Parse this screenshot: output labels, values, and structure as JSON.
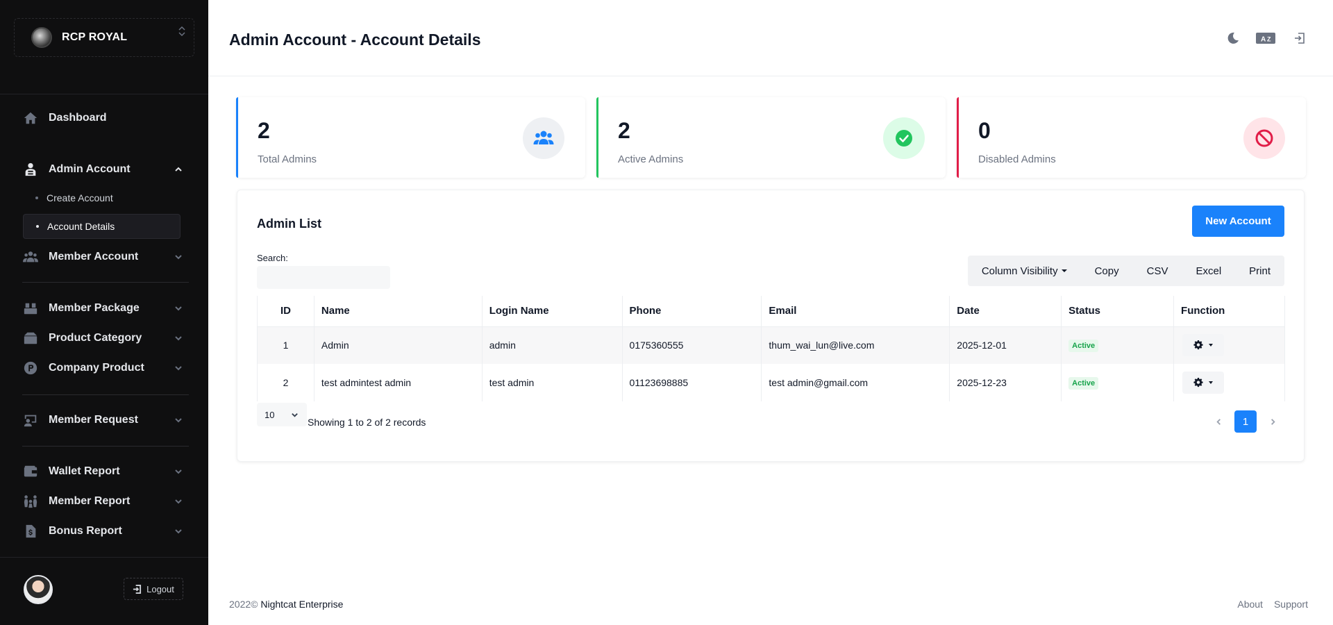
{
  "brand": {
    "name": "RCP ROYAL"
  },
  "sidebar": {
    "items": [
      {
        "label": "Dashboard",
        "icon": "home-icon"
      },
      {
        "label": "Admin Account",
        "icon": "admin-icon"
      },
      {
        "label": "Member Account",
        "icon": "users-icon"
      },
      {
        "label": "Member Package",
        "icon": "package-icon"
      },
      {
        "label": "Product Category",
        "icon": "category-icon"
      },
      {
        "label": "Company Product",
        "icon": "product-icon"
      },
      {
        "label": "Member Request",
        "icon": "request-icon"
      },
      {
        "label": "Wallet Report",
        "icon": "wallet-icon"
      },
      {
        "label": "Member Report",
        "icon": "member-report-icon"
      },
      {
        "label": "Bonus Report",
        "icon": "bonus-icon"
      }
    ],
    "sub_items": [
      {
        "label": "Create Account"
      },
      {
        "label": "Account Details"
      }
    ],
    "logout_label": "Logout"
  },
  "header": {
    "title": "Admin Account - Account Details"
  },
  "stats": [
    {
      "value": "2",
      "label": "Total Admins",
      "color": "#1a82fb"
    },
    {
      "value": "2",
      "label": "Active Admins",
      "color": "#22c55e"
    },
    {
      "value": "0",
      "label": "Disabled Admins",
      "color": "#e11d48"
    }
  ],
  "list": {
    "title": "Admin List",
    "new_button": "New Account",
    "search_label": "Search:",
    "search_value": "",
    "buttons": {
      "column_visibility": "Column Visibility",
      "copy": "Copy",
      "csv": "CSV",
      "excel": "Excel",
      "print": "Print"
    },
    "columns": [
      "ID",
      "Name",
      "Login Name",
      "Phone",
      "Email",
      "Date",
      "Status",
      "Function"
    ],
    "rows": [
      {
        "id": "1",
        "name": "Admin",
        "login": "admin",
        "phone": "0175360555",
        "email": "thum_wai_lun@live.com",
        "date": "2025-12-01",
        "status": "Active"
      },
      {
        "id": "2",
        "name": "test admintest admin",
        "login": "test admin",
        "phone": "01123698885",
        "email": "test admin@gmail.com",
        "date": "2025-12-23",
        "status": "Active"
      }
    ],
    "page_length": "10",
    "info": "Showing 1 to 2 of 2 records",
    "current_page": "1"
  },
  "footer": {
    "year": "2022©",
    "company": "Nightcat Enterprise",
    "about": "About",
    "support": "Support"
  },
  "colors": {
    "accent": "#1a82fb",
    "sidebar_bg": "#0f0f10",
    "success": "#16a34a",
    "danger": "#e11d48"
  }
}
